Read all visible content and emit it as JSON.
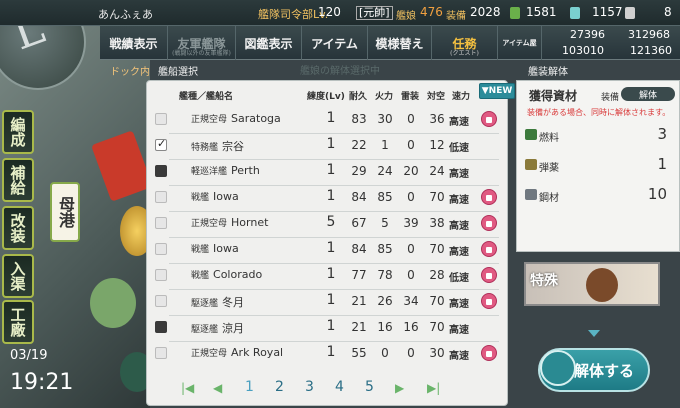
{
  "top": {
    "player_name": "あんふぇあ",
    "title": "艦隊司令部Lv.",
    "level": "120",
    "rank": "[元帥]",
    "ships_label": "艦娘",
    "ships_count": "476",
    "equip_label": "装備",
    "equip_count": "2028",
    "bucket_count": "1581",
    "devmat_count": "1157",
    "screw_count": "8"
  },
  "menu": {
    "items": [
      {
        "label": "戦績表示",
        "sub": ""
      },
      {
        "label": "友軍艦隊",
        "sub": "(戦闘以外の友軍艦隊)"
      },
      {
        "label": "図鑑表示",
        "sub": ""
      },
      {
        "label": "アイテム",
        "sub": ""
      },
      {
        "label": "模様替え",
        "sub": ""
      },
      {
        "label": "任務",
        "sub": "(クエスト)"
      }
    ],
    "shop_label": "アイテム屋",
    "res_fuel": "27396",
    "res_ammo": "312968",
    "res_steel": "103010",
    "res_bauxite": "121360"
  },
  "sections": {
    "dock_label": "ドック内",
    "ship_select_label": "艦船選択",
    "ghost_label": "艦娘の解体選択中",
    "scrap_label": "艦装解体"
  },
  "side_menu": {
    "items": [
      "編成",
      "補給",
      "改装",
      "入渠",
      "工廠"
    ],
    "bomb_label": "母港"
  },
  "list": {
    "headers": {
      "type_name": "艦種／艦船名",
      "lv": "練度(Lv)",
      "hp": "耐久",
      "fp": "火力",
      "tp": "雷装",
      "aa": "対空",
      "speed": "速力"
    },
    "new_label": "NEW",
    "rows": [
      {
        "type": "正規空母",
        "name": "Saratoga",
        "lv": "1",
        "hp": "83",
        "fp": "30",
        "tp": "0",
        "aa": "36",
        "speed": "高速",
        "check": "none",
        "locked": true
      },
      {
        "type": "特務艦",
        "name": "宗谷",
        "lv": "1",
        "hp": "22",
        "fp": "1",
        "tp": "0",
        "aa": "12",
        "speed": "低速",
        "check": "checked",
        "locked": false
      },
      {
        "type": "軽巡洋艦",
        "name": "Perth",
        "lv": "1",
        "hp": "29",
        "fp": "24",
        "tp": "20",
        "aa": "24",
        "speed": "高速",
        "check": "dark",
        "locked": false
      },
      {
        "type": "戦艦",
        "name": "Iowa",
        "lv": "1",
        "hp": "84",
        "fp": "85",
        "tp": "0",
        "aa": "70",
        "speed": "高速",
        "check": "none",
        "locked": true
      },
      {
        "type": "正規空母",
        "name": "Hornet",
        "lv": "5",
        "hp": "67",
        "fp": "5",
        "tp": "39",
        "aa": "38",
        "speed": "高速",
        "check": "none",
        "locked": true
      },
      {
        "type": "戦艦",
        "name": "Iowa",
        "lv": "1",
        "hp": "84",
        "fp": "85",
        "tp": "0",
        "aa": "70",
        "speed": "高速",
        "check": "none",
        "locked": true
      },
      {
        "type": "戦艦",
        "name": "Colorado",
        "lv": "1",
        "hp": "77",
        "fp": "78",
        "tp": "0",
        "aa": "28",
        "speed": "低速",
        "check": "none",
        "locked": true
      },
      {
        "type": "駆逐艦",
        "name": "冬月",
        "lv": "1",
        "hp": "21",
        "fp": "26",
        "tp": "34",
        "aa": "70",
        "speed": "高速",
        "check": "none",
        "locked": true
      },
      {
        "type": "駆逐艦",
        "name": "涼月",
        "lv": "1",
        "hp": "21",
        "fp": "16",
        "tp": "16",
        "aa": "70",
        "speed": "高速",
        "check": "dark",
        "locked": false
      },
      {
        "type": "正規空母",
        "name": "Ark Royal",
        "lv": "1",
        "hp": "55",
        "fp": "0",
        "tp": "0",
        "aa": "30",
        "speed": "高速",
        "check": "none",
        "locked": true
      }
    ],
    "pages": [
      "1",
      "2",
      "3",
      "4",
      "5"
    ]
  },
  "right": {
    "title": "獲得資材",
    "equip_label": "装備",
    "toggle_label": "解体",
    "note": "装備がある場合、同時に解体されます。",
    "resources": [
      {
        "label": "燃料",
        "value": "3",
        "color": "#3c7a3c"
      },
      {
        "label": "弾薬",
        "value": "1",
        "color": "#8a7a3a"
      },
      {
        "label": "鋼材",
        "value": "10",
        "color": "#707880"
      }
    ],
    "banner_tag": "特殊",
    "scrap_button": "解体する"
  },
  "clock": {
    "date": "03/19",
    "time": "19:21"
  }
}
